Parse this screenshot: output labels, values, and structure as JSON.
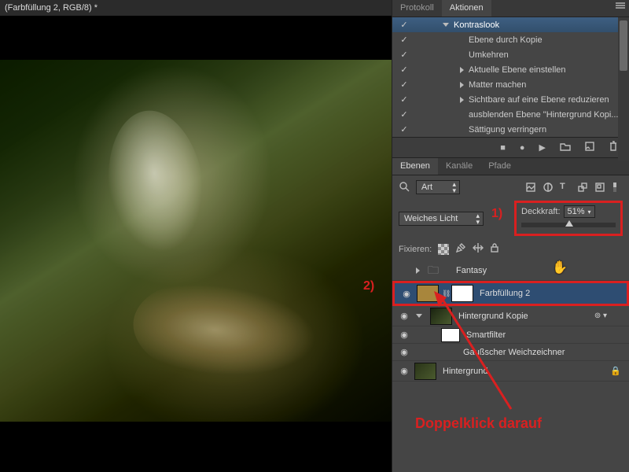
{
  "document": {
    "tab_title": "(Farbfüllung 2, RGB/8) *"
  },
  "actions_panel": {
    "tabs": {
      "protokoll": "Protokoll",
      "aktionen": "Aktionen"
    },
    "rows": [
      {
        "checked": true,
        "level": 1,
        "expand": "down",
        "label": "Kontraslook",
        "selected": true
      },
      {
        "checked": true,
        "level": 2,
        "expand": "none",
        "label": "Ebene durch Kopie"
      },
      {
        "checked": true,
        "level": 2,
        "expand": "none",
        "label": "Umkehren"
      },
      {
        "checked": true,
        "level": 2,
        "expand": "right",
        "label": "Aktuelle Ebene einstellen"
      },
      {
        "checked": true,
        "level": 2,
        "expand": "right",
        "label": "Matter machen"
      },
      {
        "checked": true,
        "level": 2,
        "expand": "right",
        "label": "Sichtbare auf eine Ebene reduzieren"
      },
      {
        "checked": true,
        "level": 2,
        "expand": "none",
        "label": "ausblenden Ebene \"Hintergrund Kopi..."
      },
      {
        "checked": true,
        "level": 2,
        "expand": "none",
        "label": "Sättigung verringern"
      }
    ],
    "toolbar": [
      "stop",
      "record",
      "play",
      "folder",
      "new",
      "trash"
    ]
  },
  "layers_panel": {
    "tabs": {
      "ebenen": "Ebenen",
      "kanaele": "Kanäle",
      "pfade": "Pfade"
    },
    "filter_dd": "Art",
    "blend_mode": "Weiches Licht",
    "opacity": {
      "label": "Deckkraft:",
      "value": "51%",
      "percent": 51
    },
    "lock": {
      "label": "Fixieren:"
    },
    "layers": [
      {
        "eye": false,
        "type": "group",
        "name": "Fantasy",
        "expand": "right"
      },
      {
        "eye": true,
        "type": "fill",
        "name": "Farbfüllung 2",
        "selected": true,
        "mask": true
      },
      {
        "eye": true,
        "type": "smart",
        "name": "Hintergrund Kopie",
        "fx": true,
        "expand": "down"
      },
      {
        "eye": true,
        "type": "smartfilter",
        "name": "Smartfilter",
        "sub": true,
        "mask": true
      },
      {
        "eye": true,
        "type": "filterline",
        "name": "Gaußscher Weichzeichner",
        "sub": true
      },
      {
        "eye": true,
        "type": "locked",
        "name": "Hintergrund",
        "locked": true
      }
    ]
  },
  "annotations": {
    "label1": "1)",
    "label2": "2)",
    "hint": "Doppelklick darauf"
  }
}
